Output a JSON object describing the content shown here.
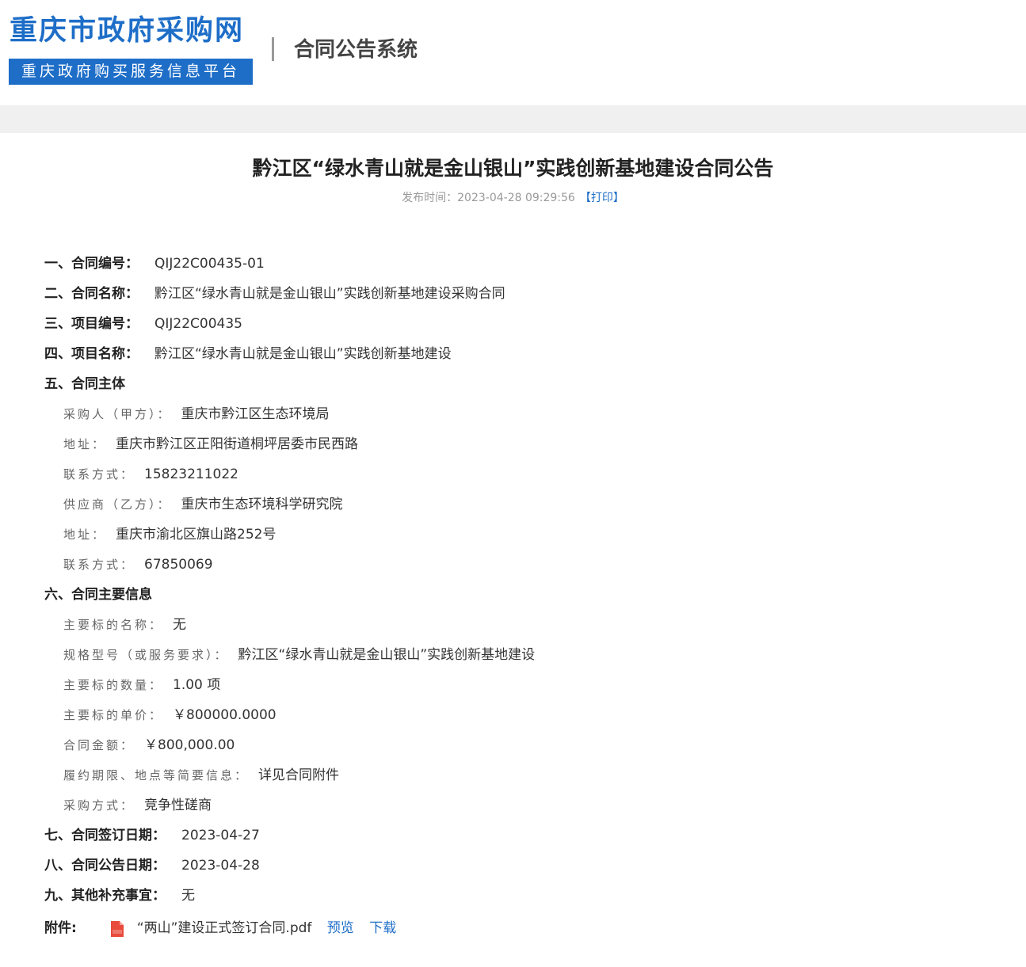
{
  "header": {
    "logo_title": "重庆市政府采购网",
    "logo_subtitle": "重庆政府购买服务信息平台",
    "system_name": "合同公告系统"
  },
  "notice": {
    "title": "黔江区“绿水青山就是金山银山”实践创新基地建设合同公告",
    "publish_label": "发布时间：",
    "publish_time": "2023-04-28 09:29:56",
    "print_label": "【打印】"
  },
  "fields": {
    "contract_no": {
      "label": "一、合同编号：",
      "value": "QIJ22C00435-01"
    },
    "contract_name": {
      "label": "二、合同名称：",
      "value": "黔江区“绿水青山就是金山银山”实践创新基地建设采购合同"
    },
    "project_no": {
      "label": "三、项目编号：",
      "value": "QIJ22C00435"
    },
    "project_name": {
      "label": "四、项目名称：",
      "value": "黔江区“绿水青山就是金山银山”实践创新基地建设"
    },
    "parties_heading": {
      "label": "五、合同主体"
    },
    "buyer": {
      "label": "采购人（甲方）：",
      "value": "重庆市黔江区生态环境局"
    },
    "buyer_address": {
      "label": "地址：",
      "value": "重庆市黔江区正阳街道桐坪居委市民西路"
    },
    "buyer_contact": {
      "label": "联系方式：",
      "value": "15823211022"
    },
    "supplier": {
      "label": "供应商（乙方）：",
      "value": "重庆市生态环境科学研究院"
    },
    "supplier_address": {
      "label": "地址：",
      "value": "重庆市渝北区旗山路252号"
    },
    "supplier_contact": {
      "label": "联系方式：",
      "value": "67850069"
    },
    "main_info_heading": {
      "label": "六、合同主要信息"
    },
    "subject_name": {
      "label": "主要标的名称：",
      "value": "无"
    },
    "spec": {
      "label": "规格型号（或服务要求）：",
      "value": "黔江区“绿水青山就是金山银山”实践创新基地建设"
    },
    "quantity": {
      "label": "主要标的数量：",
      "value": "1.00 项"
    },
    "unit_price": {
      "label": "主要标的单价：",
      "value": "￥800000.0000"
    },
    "amount": {
      "label": "合同金额：",
      "value": "￥800,000.00"
    },
    "term": {
      "label": "履约期限、地点等简要信息：",
      "value": "详见合同附件"
    },
    "method": {
      "label": "采购方式：",
      "value": "竞争性磋商"
    },
    "sign_date": {
      "label": "七、合同签订日期：",
      "value": "2023-04-27"
    },
    "publish_date": {
      "label": "八、合同公告日期：",
      "value": "2023-04-28"
    },
    "other": {
      "label": "九、其他补充事宜：",
      "value": "无"
    }
  },
  "attachment": {
    "label": "附件:",
    "icon": "pdf-file-icon",
    "file_name": "“两山”建设正式签订合同.pdf",
    "preview_label": "预览",
    "download_label": "下载"
  },
  "colors": {
    "brand_blue": "#1e6ec8",
    "pdf_red": "#e84a3c",
    "band_gray": "#f0f0f0"
  }
}
